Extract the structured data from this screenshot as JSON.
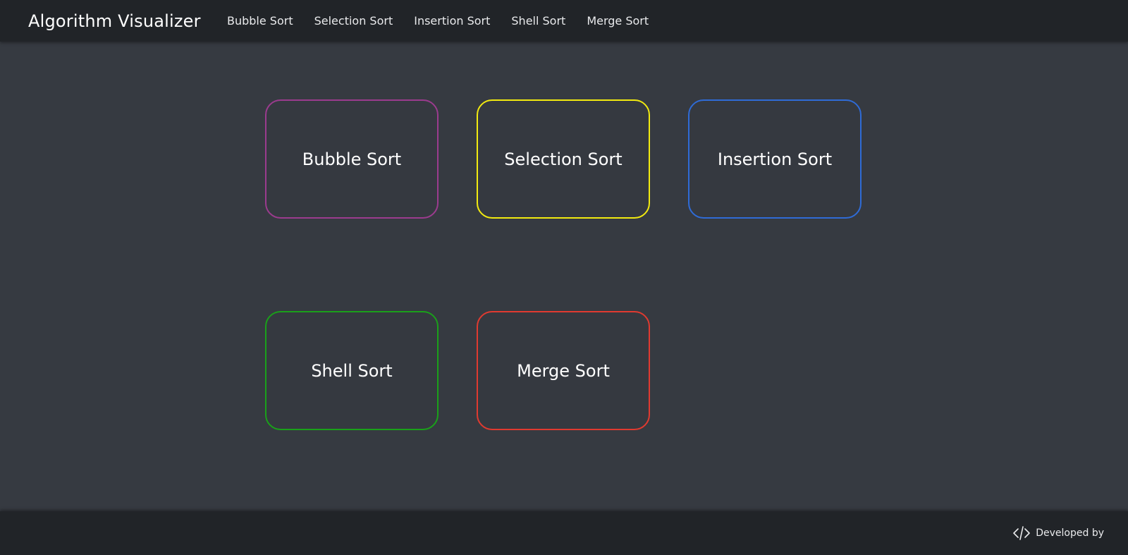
{
  "navbar": {
    "brand": "Algorithm Visualizer",
    "links": [
      {
        "label": "Bubble Sort"
      },
      {
        "label": "Selection Sort"
      },
      {
        "label": "Insertion Sort"
      },
      {
        "label": "Shell Sort"
      },
      {
        "label": "Merge Sort"
      }
    ]
  },
  "cards": [
    {
      "label": "Bubble Sort",
      "border_color": "#9b3b8e"
    },
    {
      "label": "Selection Sort",
      "border_color": "#f2ea10"
    },
    {
      "label": "Insertion Sort",
      "border_color": "#2f6bd6"
    },
    {
      "label": "Shell Sort",
      "border_color": "#1aa01a"
    },
    {
      "label": "Merge Sort",
      "border_color": "#e03a30"
    }
  ],
  "footer": {
    "icon": "code-icon",
    "credit_text": "Developed by"
  },
  "colors": {
    "background": "#363a41",
    "navbar": "#212428",
    "footer": "#212428",
    "text": "#ffffff"
  }
}
